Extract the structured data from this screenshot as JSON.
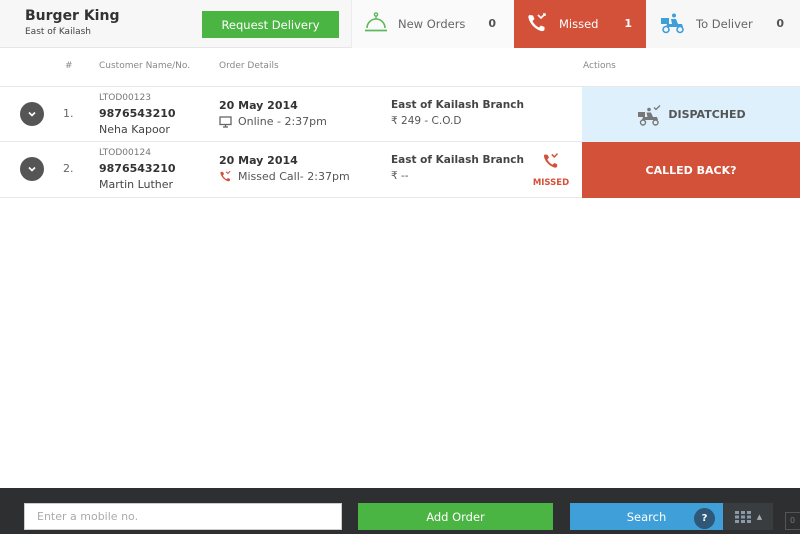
{
  "header": {
    "brand_name": "Burger King",
    "branch": "East of Kailash",
    "request_delivery_label": "Request Delivery",
    "tabs": {
      "new_orders": {
        "label": "New Orders",
        "count": "0",
        "icon": "food-cloche-icon"
      },
      "missed": {
        "label": "Missed",
        "count": "1",
        "icon": "missed-call-icon"
      },
      "to_deliver": {
        "label": "To Deliver",
        "count": "0",
        "icon": "delivery-scooter-icon"
      }
    }
  },
  "columns": {
    "index": "#",
    "customer": "Customer Name/No.",
    "details": "Order Details",
    "actions": "Actions"
  },
  "orders": [
    {
      "index": "1.",
      "order_id": "LTOD00123",
      "phone": "9876543210",
      "name": "Neha Kapoor",
      "date": "20 May 2014",
      "channel": "Online - 2:37pm",
      "channel_icon": "monitor-icon",
      "branch": "East of Kailash Branch",
      "amount": "₹ 249 - C.O.D",
      "action_label": "DISPATCHED",
      "action_icon": "dispatched-scooter-icon"
    },
    {
      "index": "2.",
      "order_id": "LTOD00124",
      "phone": "9876543210",
      "name": "Martin Luther",
      "date": "20 May 2014",
      "channel": "Missed Call- 2:37pm",
      "channel_icon": "missed-call-icon",
      "branch": "East of Kailash Branch",
      "amount": "₹ --",
      "status_label": "MISSED",
      "action_label": "CALLED BACK?"
    }
  ],
  "footer": {
    "mobile_placeholder": "Enter a mobile no.",
    "add_order_label": "Add Order",
    "search_label": "Search",
    "help_label": "?",
    "mini_value": "0"
  },
  "colors": {
    "green": "#4bb543",
    "missed_red": "#d35139",
    "blue": "#3f9fd8",
    "dispatched_bg": "#ddf0fb",
    "footer_bg": "#2d2f31"
  }
}
